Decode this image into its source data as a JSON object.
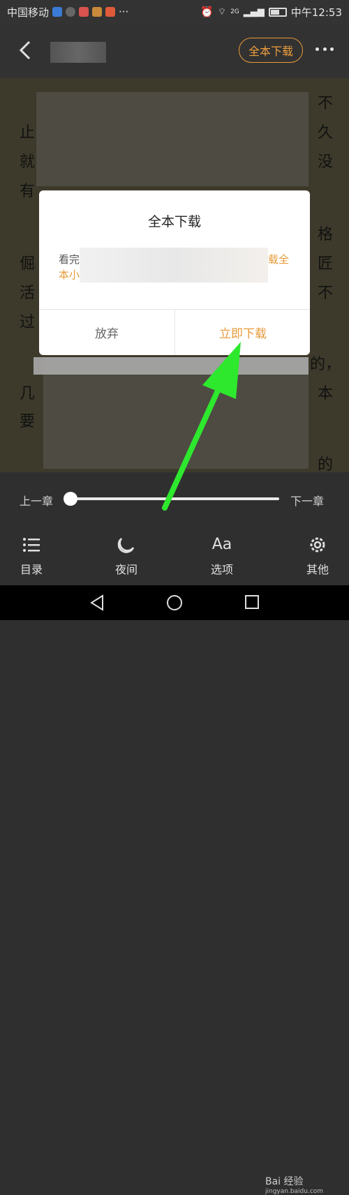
{
  "status": {
    "carrier": "中国移动",
    "time": "中午12:53",
    "network": "2G"
  },
  "topbar": {
    "full_download_label": "全本下载"
  },
  "reader": {
    "glyphs": [
      "不",
      "止",
      "久",
      "就",
      "没",
      "有",
      "格",
      "倔",
      "匠",
      "活",
      "不",
      "过",
      "的，",
      "几",
      "本",
      "要",
      "的"
    ]
  },
  "dialog": {
    "title": "全本下载",
    "body_start": "看完",
    "body_accent_end": "载全",
    "body_accent_line2": "本小",
    "cancel_label": "放弃",
    "confirm_label": "立即下载"
  },
  "chapter": {
    "prev_label": "上一章",
    "next_label": "下一章",
    "progress": 0.0
  },
  "menu": {
    "items": [
      {
        "label": "目录",
        "icon": "list-icon"
      },
      {
        "label": "夜间",
        "icon": "night-mode-icon"
      },
      {
        "label": "选项",
        "icon": "font-icon"
      },
      {
        "label": "其他",
        "icon": "gear-icon"
      }
    ],
    "font_icon_text": "Aa"
  },
  "watermark": {
    "brand": "Bai 经验",
    "url": "jingyan.baidu.com"
  },
  "colors": {
    "accent": "#e79a39",
    "annotation_arrow": "#2ee82e"
  }
}
